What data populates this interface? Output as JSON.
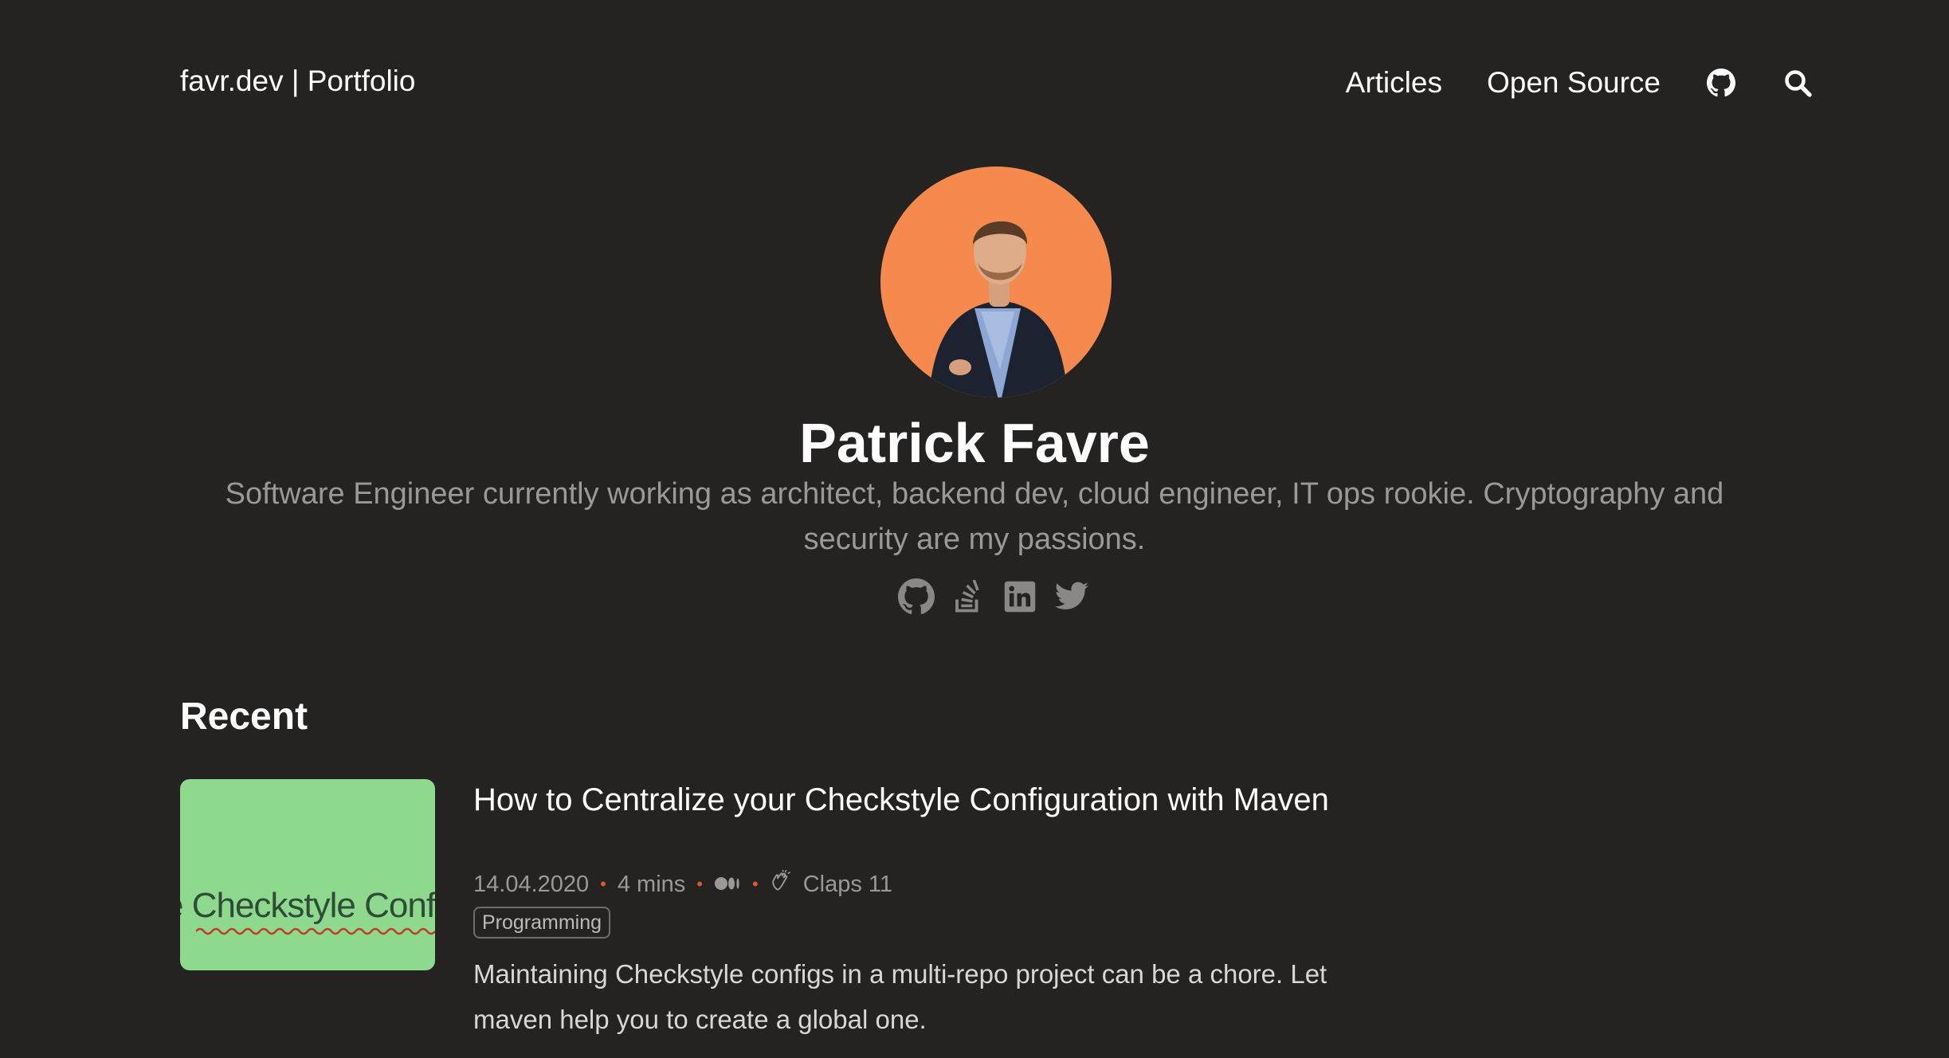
{
  "header": {
    "site_title": "favr.dev | Portfolio",
    "nav": {
      "articles": "Articles",
      "open_source": "Open Source",
      "github_icon": "github-icon",
      "search_icon": "search-icon"
    }
  },
  "profile": {
    "name": "Patrick Favre",
    "bio": "Software Engineer currently working as architect, backend dev, cloud engineer, IT ops rookie. Cryptography and security are my passions.",
    "social_icons": [
      "github-icon",
      "stackoverflow-icon",
      "linkedin-icon",
      "twitter-icon"
    ]
  },
  "recent": {
    "heading": "Recent",
    "posts": [
      {
        "title": "How to Centralize your Checkstyle Configuration with Maven",
        "date": "14.04.2020",
        "read_time": "4 mins",
        "claps": "Claps 11",
        "tag": "Programming",
        "excerpt": "Maintaining Checkstyle configs in a multi-repo project can be a chore. Let maven help you to create a global one.",
        "thumbnail_text": "e Checkstyle Configu"
      }
    ]
  },
  "colors": {
    "background": "#252322",
    "avatar_bg": "#f6894e",
    "thumbnail_bg": "#8ed98e",
    "muted_text": "#9b9997",
    "meta_dot": "#e0582d"
  }
}
